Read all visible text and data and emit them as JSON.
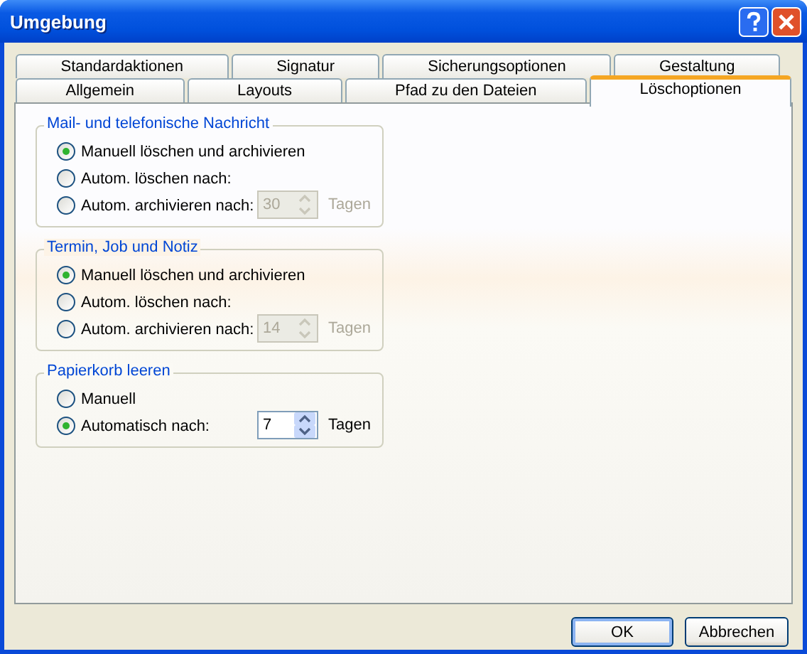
{
  "window": {
    "title": "Umgebung"
  },
  "tab_rows": [
    [
      {
        "label": "Standardaktionen",
        "selected": false
      },
      {
        "label": "Signatur",
        "selected": false
      },
      {
        "label": "Sicherungsoptionen",
        "selected": false
      },
      {
        "label": "Gestaltung",
        "selected": false
      }
    ],
    [
      {
        "label": "Allgemein",
        "selected": false
      },
      {
        "label": "Layouts",
        "selected": false
      },
      {
        "label": "Pfad zu den Dateien",
        "selected": false
      },
      {
        "label": "Löschoptionen",
        "selected": true
      }
    ]
  ],
  "groups": [
    {
      "title": "Mail- und telefonische Nachricht",
      "options": [
        {
          "label": "Manuell löschen und archivieren",
          "selected": true
        },
        {
          "label": "Autom. löschen nach:",
          "selected": false
        },
        {
          "label": "Autom. archivieren nach:",
          "selected": false
        }
      ],
      "spinner": {
        "value": "30",
        "disabled": true
      },
      "unit": "Tagen"
    },
    {
      "title": "Termin, Job und Notiz",
      "options": [
        {
          "label": "Manuell löschen und archivieren",
          "selected": true
        },
        {
          "label": "Autom. löschen nach:",
          "selected": false
        },
        {
          "label": "Autom. archivieren nach:",
          "selected": false
        }
      ],
      "spinner": {
        "value": "14",
        "disabled": true
      },
      "unit": "Tagen"
    },
    {
      "title": "Papierkorb leeren",
      "options": [
        {
          "label": "Manuell",
          "selected": false
        },
        {
          "label": "Automatisch nach:",
          "selected": true
        }
      ],
      "spinner": {
        "value": "7",
        "disabled": false
      },
      "unit": "Tagen"
    }
  ],
  "buttons": [
    {
      "label": "OK",
      "default": true
    },
    {
      "label": "Abbrechen",
      "default": false
    }
  ]
}
